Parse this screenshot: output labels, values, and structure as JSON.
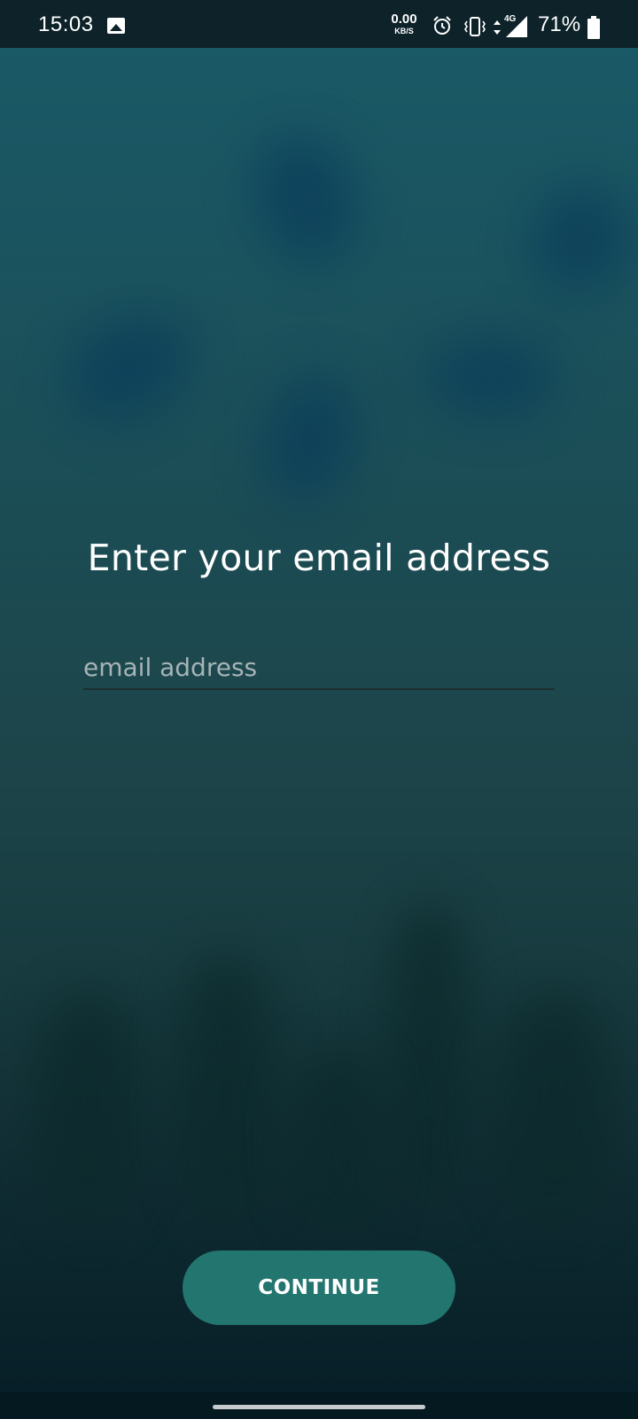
{
  "status_bar": {
    "time": "15:03",
    "net_speed_value": "0.00",
    "net_speed_unit": "KB/S",
    "network_type": "4G",
    "battery_percent": "71%",
    "icons": [
      "gallery-icon",
      "alarm-icon",
      "vibrate-icon",
      "data-arrows-icon",
      "signal-icon",
      "battery-icon"
    ]
  },
  "main": {
    "title": "Enter your email address",
    "email_input": {
      "placeholder": "email address",
      "value": ""
    },
    "continue_label": "CONTINUE"
  },
  "colors": {
    "accent": "#23756f",
    "statusbar": "#0d2229"
  }
}
